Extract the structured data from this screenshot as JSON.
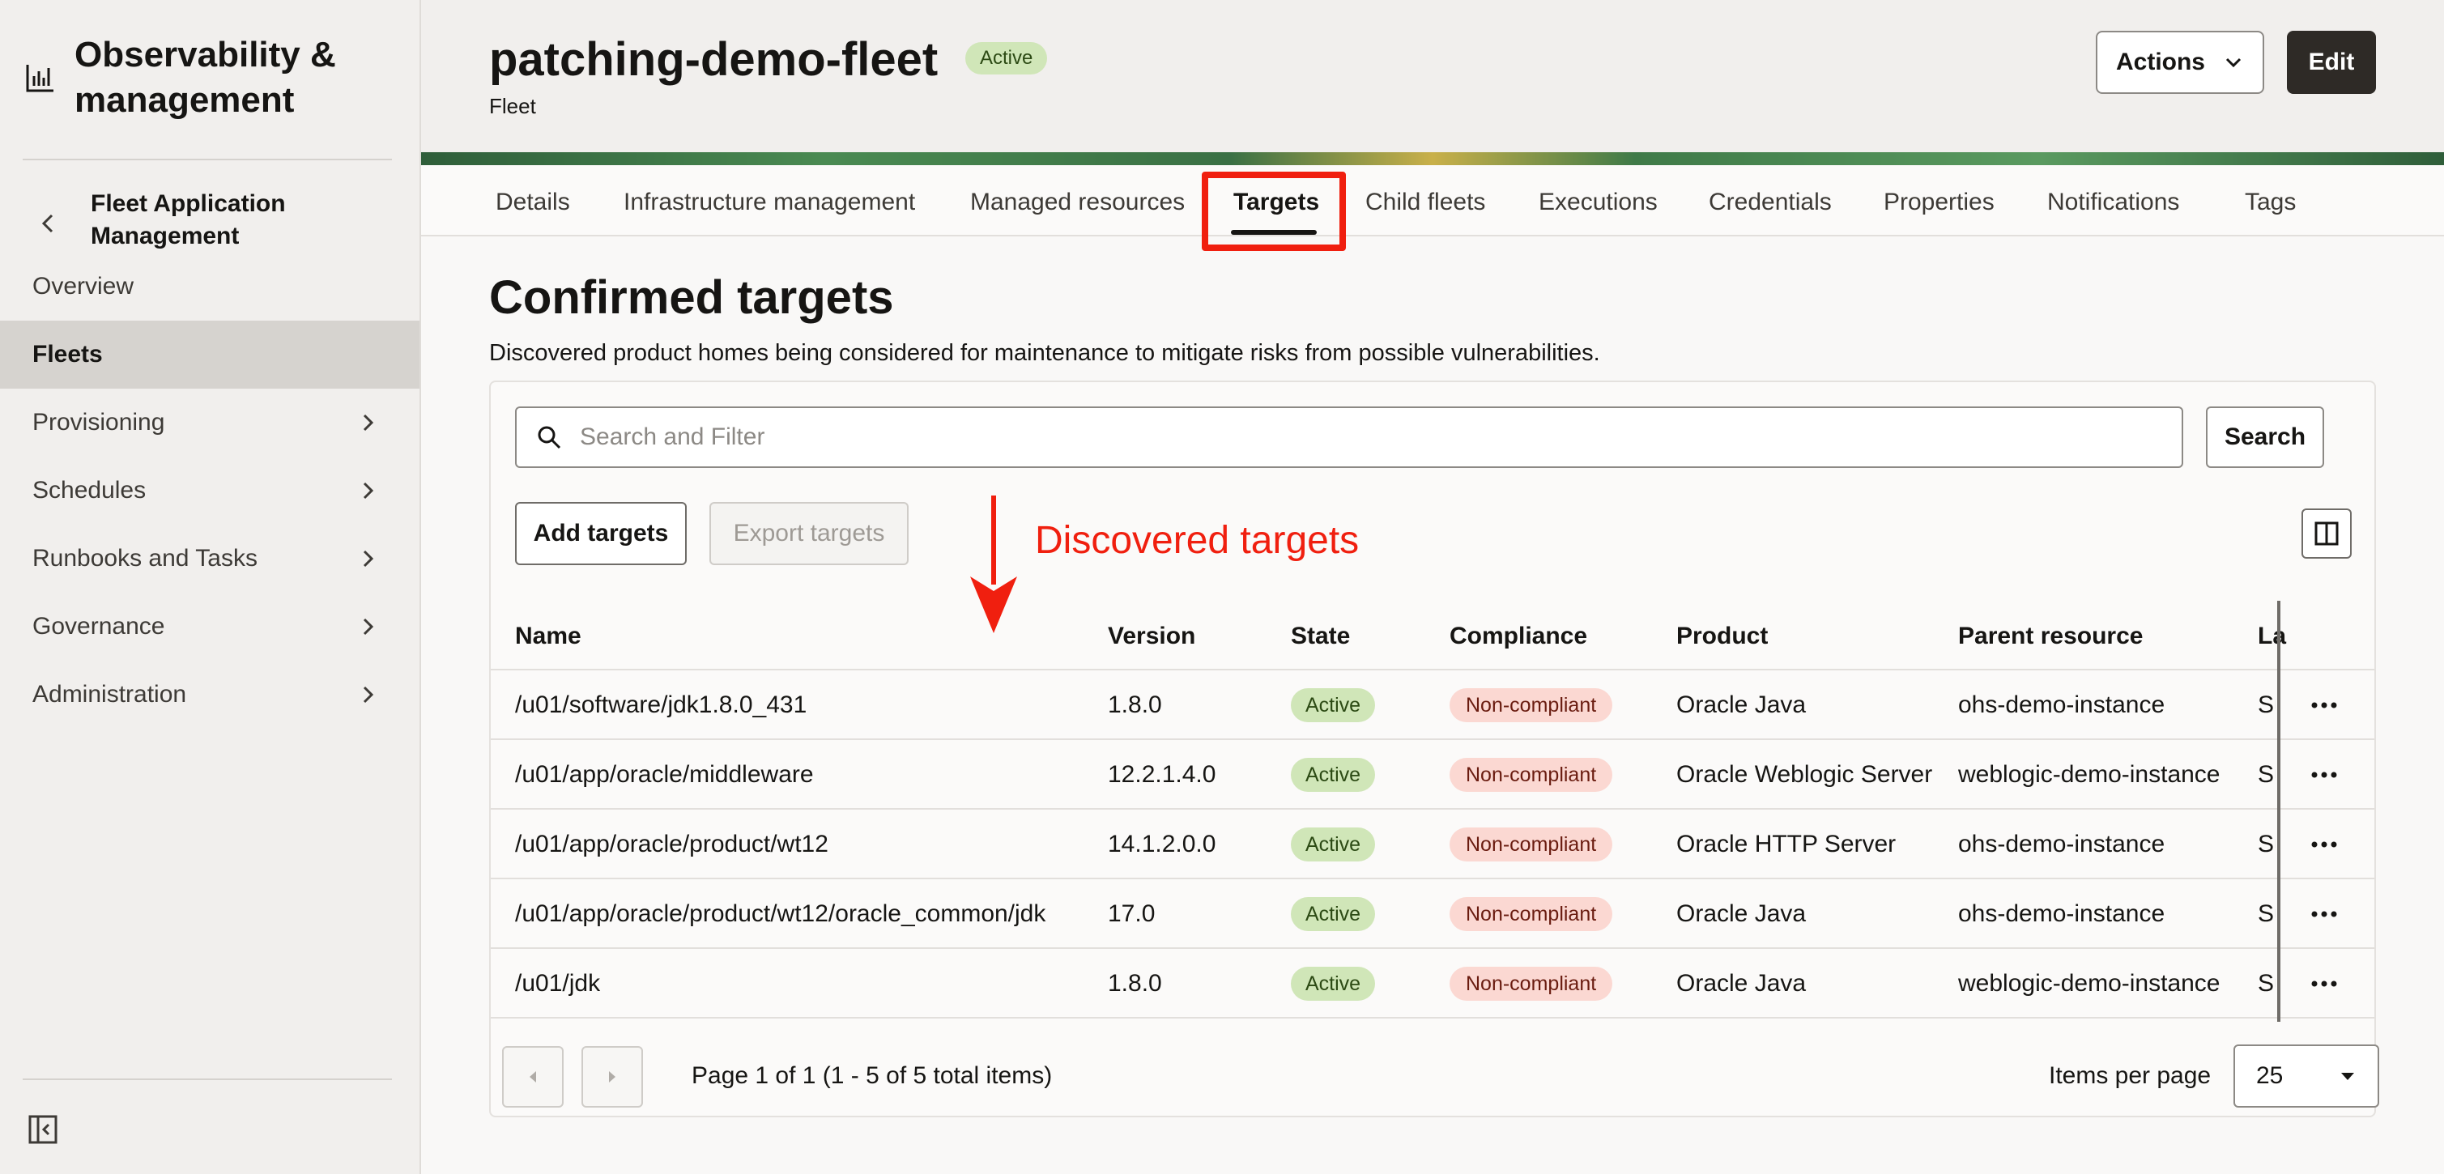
{
  "app": {
    "title": "Observability & management"
  },
  "sidebar": {
    "back_label": "Fleet Application Management",
    "items": [
      {
        "label": "Overview",
        "chevron": false,
        "active": false
      },
      {
        "label": "Fleets",
        "chevron": false,
        "active": true
      },
      {
        "label": "Provisioning",
        "chevron": true,
        "active": false
      },
      {
        "label": "Schedules",
        "chevron": true,
        "active": false
      },
      {
        "label": "Runbooks and Tasks",
        "chevron": true,
        "active": false
      },
      {
        "label": "Governance",
        "chevron": true,
        "active": false
      },
      {
        "label": "Administration",
        "chevron": true,
        "active": false
      }
    ]
  },
  "header": {
    "title": "patching-demo-fleet",
    "status": "Active",
    "subtitle": "Fleet",
    "actions_label": "Actions",
    "edit_label": "Edit"
  },
  "tabs": [
    "Details",
    "Infrastructure management",
    "Managed resources",
    "Targets",
    "Child fleets",
    "Executions",
    "Credentials",
    "Properties",
    "Notifications",
    "Tags"
  ],
  "active_tab": "Targets",
  "section": {
    "title": "Confirmed targets",
    "description": "Discovered product homes being considered for maintenance to mitigate risks from possible vulnerabilities."
  },
  "toolbar": {
    "search_placeholder": "Search and Filter",
    "search_label": "Search",
    "add_label": "Add targets",
    "export_label": "Export targets"
  },
  "annotation": {
    "text": "Discovered targets",
    "color": "#f01f0f"
  },
  "table": {
    "columns": [
      "Name",
      "Version",
      "State",
      "Compliance",
      "Product",
      "Parent resource",
      "La"
    ],
    "rows": [
      {
        "name": "/u01/software/jdk1.8.0_431",
        "version": "1.8.0",
        "state": "Active",
        "compliance": "Non-compliant",
        "product": "Oracle Java",
        "parent": "ohs-demo-instance",
        "clip": "Su"
      },
      {
        "name": "/u01/app/oracle/middleware",
        "version": "12.2.1.4.0",
        "state": "Active",
        "compliance": "Non-compliant",
        "product": "Oracle Weblogic Server",
        "parent": "weblogic-demo-instance",
        "clip": "Su"
      },
      {
        "name": "/u01/app/oracle/product/wt12",
        "version": "14.1.2.0.0",
        "state": "Active",
        "compliance": "Non-compliant",
        "product": "Oracle HTTP Server",
        "parent": "ohs-demo-instance",
        "clip": "Su"
      },
      {
        "name": "/u01/app/oracle/product/wt12/oracle_common/jdk",
        "version": "17.0",
        "state": "Active",
        "compliance": "Non-compliant",
        "product": "Oracle Java",
        "parent": "ohs-demo-instance",
        "clip": "Su"
      },
      {
        "name": "/u01/jdk",
        "version": "1.8.0",
        "state": "Active",
        "compliance": "Non-compliant",
        "product": "Oracle Java",
        "parent": "weblogic-demo-instance",
        "clip": "Su"
      }
    ]
  },
  "pagination": {
    "info": "Page 1 of 1 (1 - 5 of 5 total items)",
    "items_per_page_label": "Items per page",
    "items_per_page": "25"
  },
  "colors": {
    "accent_dark": "#2e2a26",
    "active_pill": "#d0e6b8",
    "noncompliant_pill": "#fbd8d2",
    "highlight": "#f01f0f"
  }
}
